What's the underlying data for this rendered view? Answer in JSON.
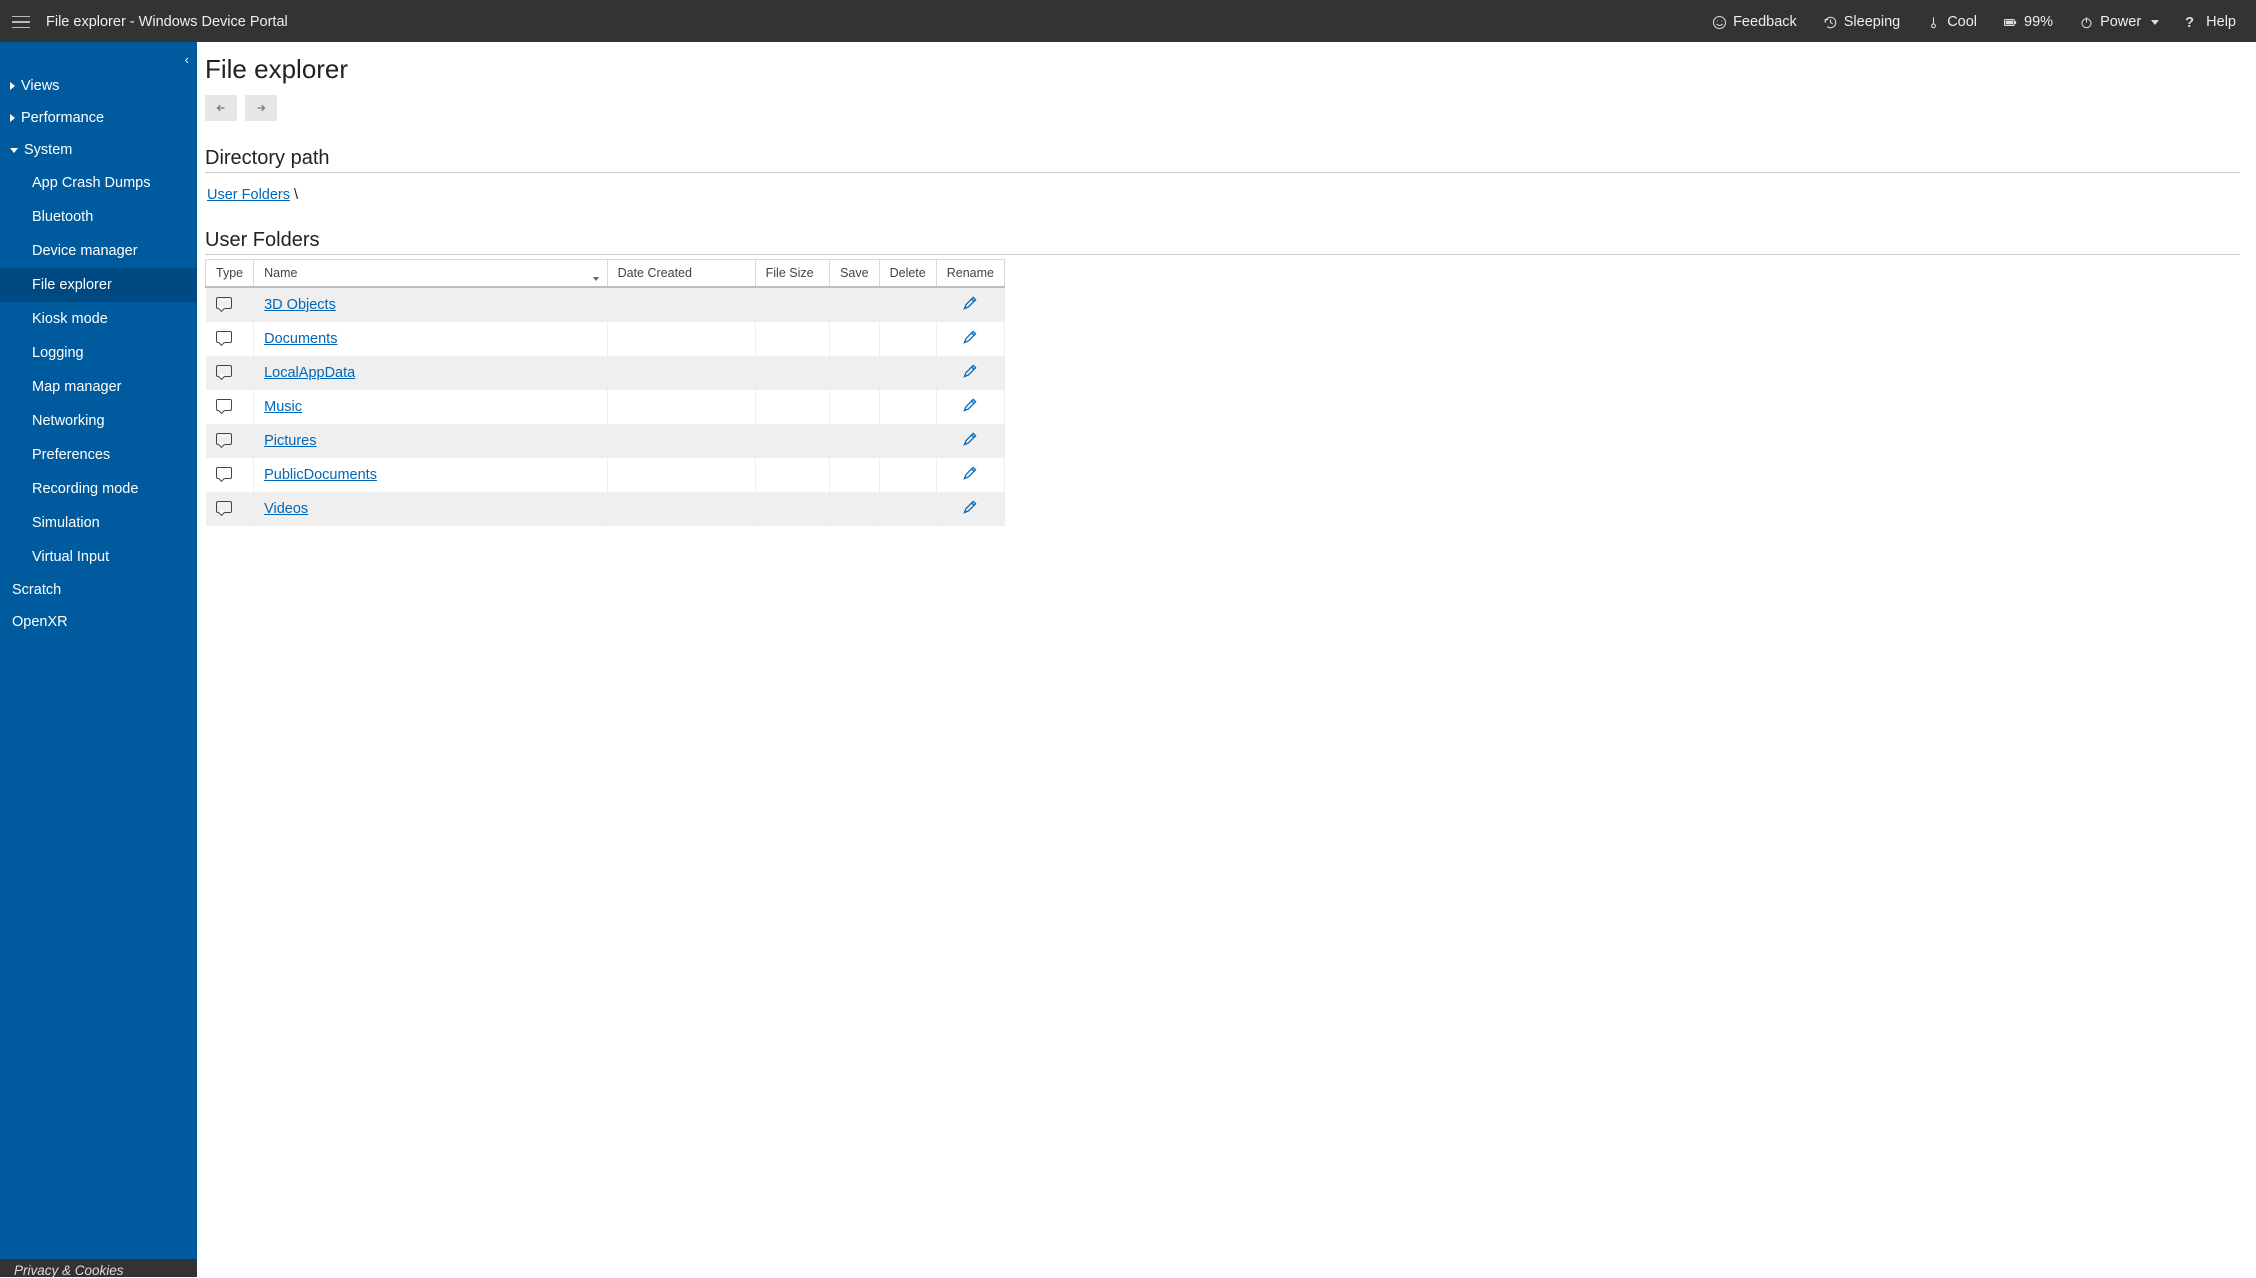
{
  "header": {
    "title": "File explorer - Windows Device Portal",
    "status": {
      "feedback": "Feedback",
      "sleeping": "Sleeping",
      "cool": "Cool",
      "battery": "99%",
      "power": "Power",
      "help": "Help"
    }
  },
  "sidebar": {
    "views": "Views",
    "performance": "Performance",
    "system": "System",
    "system_items": [
      "App Crash Dumps",
      "Bluetooth",
      "Device manager",
      "File explorer",
      "Kiosk mode",
      "Logging",
      "Map manager",
      "Networking",
      "Preferences",
      "Recording mode",
      "Simulation",
      "Virtual Input"
    ],
    "scratch": "Scratch",
    "openxr": "OpenXR",
    "footer": "Privacy & Cookies"
  },
  "main": {
    "page_title": "File explorer",
    "dir_heading": "Directory path",
    "breadcrumb_root": "User Folders",
    "breadcrumb_sep": " \\",
    "folders_heading": "User Folders",
    "columns": {
      "type": "Type",
      "name": "Name",
      "date": "Date Created",
      "size": "File Size",
      "save": "Save",
      "delete": "Delete",
      "rename": "Rename"
    },
    "rows": [
      {
        "name": "3D Objects"
      },
      {
        "name": "Documents"
      },
      {
        "name": "LocalAppData"
      },
      {
        "name": "Music"
      },
      {
        "name": "Pictures"
      },
      {
        "name": "PublicDocuments"
      },
      {
        "name": "Videos"
      }
    ]
  }
}
